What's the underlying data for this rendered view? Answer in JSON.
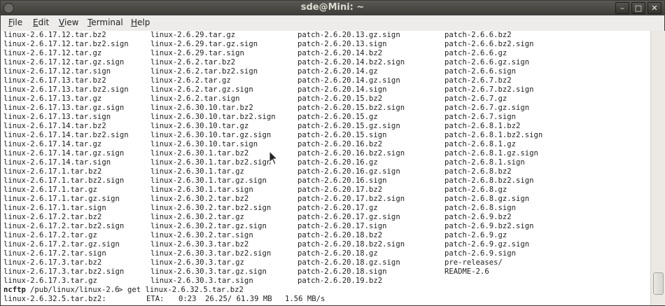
{
  "window": {
    "title": "sde@Mini: ~",
    "buttons": {
      "minimize": "–",
      "maximize": "□",
      "close": "✕"
    }
  },
  "menubar": {
    "items": [
      {
        "label": "File",
        "mnemonic": "F",
        "rest": "ile"
      },
      {
        "label": "Edit",
        "mnemonic": "E",
        "rest": "dit"
      },
      {
        "label": "View",
        "mnemonic": "V",
        "rest": "iew"
      },
      {
        "label": "Terminal",
        "mnemonic": "T",
        "rest": "erminal"
      },
      {
        "label": "Help",
        "mnemonic": "H",
        "rest": "elp"
      }
    ]
  },
  "terminal": {
    "rows": [
      [
        "linux-2.6.17.12.tar.bz2",
        "linux-2.6.29.tar.gz",
        "patch-2.6.20.13.gz.sign",
        "patch-2.6.6.bz2"
      ],
      [
        "linux-2.6.17.12.tar.bz2.sign",
        "linux-2.6.29.tar.gz.sign",
        "patch-2.6.20.13.sign",
        "patch-2.6.6.bz2.sign"
      ],
      [
        "linux-2.6.17.12.tar.gz",
        "linux-2.6.29.tar.sign",
        "patch-2.6.20.14.bz2",
        "patch-2.6.6.gz"
      ],
      [
        "linux-2.6.17.12.tar.gz.sign",
        "linux-2.6.2.tar.bz2",
        "patch-2.6.20.14.bz2.sign",
        "patch-2.6.6.gz.sign"
      ],
      [
        "linux-2.6.17.12.tar.sign",
        "linux-2.6.2.tar.bz2.sign",
        "patch-2.6.20.14.gz",
        "patch-2.6.6.sign"
      ],
      [
        "linux-2.6.17.13.tar.bz2",
        "linux-2.6.2.tar.gz",
        "patch-2.6.20.14.gz.sign",
        "patch-2.6.7.bz2"
      ],
      [
        "linux-2.6.17.13.tar.bz2.sign",
        "linux-2.6.2.tar.gz.sign",
        "patch-2.6.20.14.sign",
        "patch-2.6.7.bz2.sign"
      ],
      [
        "linux-2.6.17.13.tar.gz",
        "linux-2.6.2.tar.sign",
        "patch-2.6.20.15.bz2",
        "patch-2.6.7.gz"
      ],
      [
        "linux-2.6.17.13.tar.gz.sign",
        "linux-2.6.30.10.tar.bz2",
        "patch-2.6.20.15.bz2.sign",
        "patch-2.6.7.gz.sign"
      ],
      [
        "linux-2.6.17.13.tar.sign",
        "linux-2.6.30.10.tar.bz2.sign",
        "patch-2.6.20.15.gz",
        "patch-2.6.7.sign"
      ],
      [
        "linux-2.6.17.14.tar.bz2",
        "linux-2.6.30.10.tar.gz",
        "patch-2.6.20.15.gz.sign",
        "patch-2.6.8.1.bz2"
      ],
      [
        "linux-2.6.17.14.tar.bz2.sign",
        "linux-2.6.30.10.tar.gz.sign",
        "patch-2.6.20.15.sign",
        "patch-2.6.8.1.bz2.sign"
      ],
      [
        "linux-2.6.17.14.tar.gz",
        "linux-2.6.30.10.tar.sign",
        "patch-2.6.20.16.bz2",
        "patch-2.6.8.1.gz"
      ],
      [
        "linux-2.6.17.14.tar.gz.sign",
        "linux-2.6.30.1.tar.bz2",
        "patch-2.6.20.16.bz2.sign",
        "patch-2.6.8.1.gz.sign"
      ],
      [
        "linux-2.6.17.14.tar.sign",
        "linux-2.6.30.1.tar.bz2.sign",
        "patch-2.6.20.16.gz",
        "patch-2.6.8.1.sign"
      ],
      [
        "linux-2.6.17.1.tar.bz2",
        "linux-2.6.30.1.tar.gz",
        "patch-2.6.20.16.gz.sign",
        "patch-2.6.8.bz2"
      ],
      [
        "linux-2.6.17.1.tar.bz2.sign",
        "linux-2.6.30.1.tar.gz.sign",
        "patch-2.6.20.16.sign",
        "patch-2.6.8.bz2.sign"
      ],
      [
        "linux-2.6.17.1.tar.gz",
        "linux-2.6.30.1.tar.sign",
        "patch-2.6.20.17.bz2",
        "patch-2.6.8.gz"
      ],
      [
        "linux-2.6.17.1.tar.gz.sign",
        "linux-2.6.30.2.tar.bz2",
        "patch-2.6.20.17.bz2.sign",
        "patch-2.6.8.gz.sign"
      ],
      [
        "linux-2.6.17.1.tar.sign",
        "linux-2.6.30.2.tar.bz2.sign",
        "patch-2.6.20.17.gz",
        "patch-2.6.8.sign"
      ],
      [
        "linux-2.6.17.2.tar.bz2",
        "linux-2.6.30.2.tar.gz",
        "patch-2.6.20.17.gz.sign",
        "patch-2.6.9.bz2"
      ],
      [
        "linux-2.6.17.2.tar.bz2.sign",
        "linux-2.6.30.2.tar.gz.sign",
        "patch-2.6.20.17.sign",
        "patch-2.6.9.bz2.sign"
      ],
      [
        "linux-2.6.17.2.tar.gz",
        "linux-2.6.30.2.tar.sign",
        "patch-2.6.20.18.bz2",
        "patch-2.6.9.gz"
      ],
      [
        "linux-2.6.17.2.tar.gz.sign",
        "linux-2.6.30.3.tar.bz2",
        "patch-2.6.20.18.bz2.sign",
        "patch-2.6.9.gz.sign"
      ],
      [
        "linux-2.6.17.2.tar.sign",
        "linux-2.6.30.3.tar.bz2.sign",
        "patch-2.6.20.18.gz",
        "patch-2.6.9.sign"
      ],
      [
        "linux-2.6.17.3.tar.bz2",
        "linux-2.6.30.3.tar.gz",
        "patch-2.6.20.18.gz.sign",
        "pre-releases/"
      ],
      [
        "linux-2.6.17.3.tar.bz2.sign",
        "linux-2.6.30.3.tar.gz.sign",
        "patch-2.6.20.18.sign",
        "README-2.6"
      ],
      [
        "linux-2.6.17.3.tar.gz",
        "linux-2.6.30.3.tar.sign",
        "patch-2.6.20.19.bz2",
        ""
      ]
    ],
    "prompt": {
      "program": "ncftp",
      "path": "/pub/linux/linux-2.6",
      "symbol": ">",
      "command": "get linux-2.6.32.5.tar.bz2"
    },
    "progress": {
      "filename": "linux-2.6.32.5.tar.bz2:",
      "eta_label": "ETA:",
      "eta": "0:23",
      "transferred": "26.25/ 61.39 MB",
      "rate": "1.56 MB/s"
    }
  }
}
